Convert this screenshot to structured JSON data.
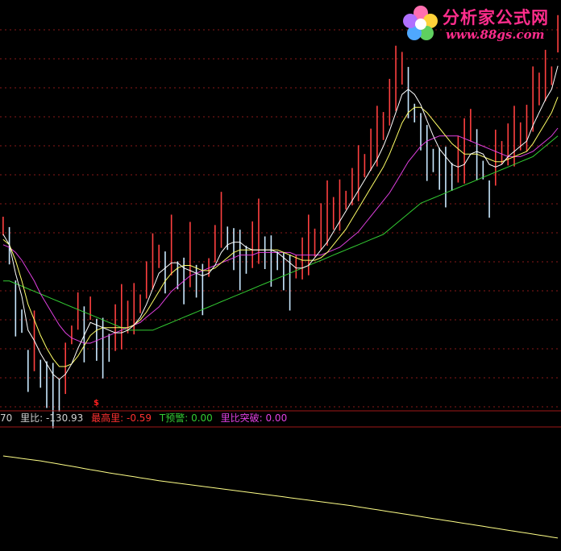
{
  "colors": {
    "background": "#000000",
    "grid": "#8a1a1a",
    "divider": "#a01818",
    "up": "#ff4040",
    "down": "#c8e8ff",
    "ma5": "#ffffff",
    "ma10": "#ffff66",
    "ma20": "#e040e0",
    "ma60": "#33cc33",
    "sub_line": "#ffff88"
  },
  "logo": {
    "title": "分析家公式网",
    "url": "www.88gs.com",
    "icon": "flower-icon"
  },
  "signal_mark": "$",
  "indicators": [
    {
      "id": "left",
      "text": "70",
      "color": "#d0d0d0"
    },
    {
      "id": "ratio",
      "text": "里比: -130.93",
      "color": "#d0d0d0"
    },
    {
      "id": "maxvol",
      "text": "最高里: -0.59",
      "color": "#ff3030"
    },
    {
      "id": "warn",
      "text": "T预警: 0.00",
      "color": "#33cc33"
    },
    {
      "id": "breakout",
      "text": "里比突破: 0.00",
      "color": "#e040e0"
    }
  ],
  "chart_data": {
    "type": "line",
    "title": "",
    "xlabel": "",
    "ylabel": "",
    "bars": 90,
    "main_ylim": [
      0,
      100
    ],
    "series": [
      {
        "key": "price",
        "values": [
          72,
          68,
          45,
          38,
          20,
          25,
          18,
          15,
          12,
          10,
          15,
          30,
          38,
          35,
          40,
          32,
          30,
          28,
          31,
          34,
          36,
          38,
          42,
          50,
          56,
          60,
          58,
          62,
          56,
          55,
          58,
          54,
          52,
          56,
          64,
          72,
          70,
          67,
          64,
          62,
          63,
          67,
          65,
          63,
          61,
          58,
          55,
          56,
          58,
          62,
          65,
          70,
          74,
          76,
          78,
          82,
          86,
          90,
          95,
          100,
          104,
          110,
          118,
          126,
          132,
          128,
          118,
          112,
          105,
          100,
          98,
          96,
          94,
          96,
          98,
          110,
          104,
          96,
          86,
          96,
          100,
          102,
          104,
          106,
          108,
          118,
          124,
          128,
          130,
          145
        ]
      },
      {
        "key": "ma5",
        "values": [
          70,
          66,
          55,
          46,
          33,
          29,
          24,
          20,
          16,
          14,
          16,
          20,
          26,
          31,
          36,
          35,
          34,
          33,
          32,
          32,
          33,
          35,
          38,
          43,
          49,
          55,
          57,
          59,
          59,
          57,
          56,
          55,
          54,
          55,
          58,
          63,
          66,
          67,
          67,
          65,
          64,
          64,
          64,
          64,
          63,
          61,
          59,
          57,
          57,
          58,
          61,
          64,
          67,
          71,
          75,
          79,
          83,
          87,
          91,
          95,
          99,
          104,
          110,
          117,
          124,
          126,
          124,
          120,
          114,
          108,
          103,
          100,
          97,
          96,
          97,
          101,
          102,
          101,
          97,
          96,
          97,
          100,
          102,
          104,
          106,
          112,
          117,
          122,
          126,
          135
        ]
      },
      {
        "key": "ma10",
        "values": [
          68,
          66,
          60,
          52,
          43,
          37,
          31,
          26,
          22,
          19,
          19,
          20,
          23,
          27,
          31,
          33,
          34,
          34,
          34,
          34,
          34,
          35,
          37,
          40,
          44,
          48,
          52,
          55,
          57,
          58,
          58,
          57,
          56,
          56,
          57,
          59,
          61,
          63,
          64,
          64,
          64,
          64,
          64,
          64,
          64,
          63,
          62,
          61,
          60,
          60,
          60,
          61,
          63,
          66,
          69,
          72,
          76,
          80,
          84,
          88,
          92,
          96,
          101,
          107,
          113,
          117,
          119,
          119,
          117,
          114,
          111,
          108,
          105,
          103,
          101,
          101,
          101,
          100,
          99,
          98,
          98,
          99,
          100,
          101,
          102,
          105,
          109,
          113,
          117,
          123
        ]
      },
      {
        "key": "ma20",
        "values": [
          66,
          65,
          63,
          60,
          56,
          52,
          47,
          43,
          39,
          35,
          32,
          30,
          29,
          28,
          28,
          29,
          30,
          31,
          32,
          33,
          34,
          35,
          36,
          38,
          40,
          42,
          45,
          48,
          50,
          52,
          54,
          55,
          56,
          57,
          58,
          59,
          60,
          61,
          62,
          62,
          62,
          63,
          63,
          63,
          63,
          63,
          63,
          62,
          62,
          62,
          62,
          62,
          63,
          64,
          65,
          67,
          69,
          71,
          74,
          77,
          80,
          83,
          86,
          90,
          94,
          98,
          101,
          104,
          106,
          107,
          108,
          108,
          108,
          108,
          107,
          106,
          105,
          104,
          103,
          102,
          101,
          100,
          100,
          100,
          101,
          102,
          104,
          106,
          108,
          111
        ]
      },
      {
        "key": "ma60",
        "values": [
          52,
          52,
          51,
          50,
          49,
          48,
          47,
          46,
          45,
          44,
          43,
          42,
          41,
          40,
          39,
          38,
          37,
          36,
          35,
          34,
          33,
          33,
          33,
          33,
          33,
          34,
          35,
          36,
          37,
          38,
          39,
          40,
          41,
          42,
          43,
          44,
          45,
          46,
          47,
          48,
          49,
          50,
          51,
          52,
          53,
          54,
          55,
          56,
          57,
          58,
          59,
          60,
          61,
          62,
          63,
          64,
          65,
          66,
          67,
          68,
          69,
          70,
          72,
          74,
          76,
          78,
          80,
          82,
          83,
          84,
          85,
          86,
          87,
          88,
          89,
          90,
          91,
          92,
          93,
          94,
          95,
          96,
          97,
          98,
          99,
          100,
          102,
          104,
          106,
          108
        ]
      },
      {
        "key": "sub",
        "values": [
          100,
          99.5,
          99,
          98.5,
          98,
          97.5,
          97,
          96.3,
          95.7,
          95,
          94.3,
          93.7,
          93,
          92.3,
          91.6,
          91,
          90.3,
          89.6,
          89,
          88.4,
          87.8,
          87.2,
          86.6,
          86,
          85.4,
          84.8,
          84.3,
          83.8,
          83.3,
          82.8,
          82.3,
          81.8,
          81.3,
          80.8,
          80.3,
          79.8,
          79.3,
          78.8,
          78.3,
          77.8,
          77.3,
          76.8,
          76.3,
          75.8,
          75.3,
          74.8,
          74.3,
          73.8,
          73.3,
          72.8,
          72.3,
          71.8,
          71.3,
          70.8,
          70.3,
          69.8,
          69.3,
          68.7,
          68.1,
          67.5,
          66.9,
          66.3,
          65.7,
          65.1,
          64.5,
          63.9,
          63.3,
          62.7,
          62.1,
          61.5,
          60.9,
          60.3,
          59.7,
          59.1,
          58.5,
          57.9,
          57.3,
          56.7,
          56.1,
          55.5,
          54.9,
          54.3,
          53.7,
          53.1,
          52.5,
          51.9,
          51.3,
          50.7,
          50.1,
          49.5
        ]
      }
    ]
  }
}
